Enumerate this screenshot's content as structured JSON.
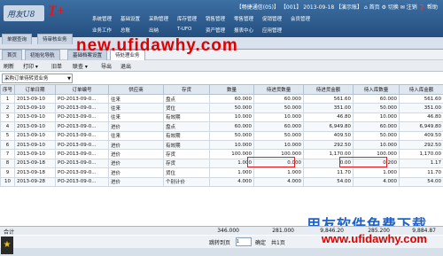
{
  "app": {
    "logo_text": "用友U8",
    "logo_mark": "T+",
    "status": "【畅捷通信(05)】 【001】 2013-09-18 【演示账】 ⌂ 首页 ⚙ 切换 ✉ 注销 ❓ 帮助"
  },
  "menu_row1": [
    "系统管理",
    "基础设置",
    "采购管理",
    "库存管理",
    "销售管理",
    "零售管理",
    "促销管理",
    "会员管理"
  ],
  "menu_row2": [
    "业务工作",
    "总账",
    "出纳",
    "T-UFO",
    "资产管理",
    "报表中心",
    "应用管理"
  ],
  "watermark_top": "new.ufidawhy.com",
  "tabs": {
    "t1": "单据查询",
    "t2": "待审核业务",
    "t3": "首页",
    "t4": "初始化导航",
    "t5": "基础档案设置",
    "t6": "待处理业务"
  },
  "toolbar": {
    "refresh": "刷新",
    "print": "打印 ▾",
    "history": "旧单",
    "link": "联查 ▾",
    "export": "导出",
    "exit": "退出"
  },
  "filter": {
    "value": "采购订单待转货业务"
  },
  "table": {
    "headers": [
      "序号",
      "订单日期",
      "订单编号",
      "供应商",
      "存货",
      "数量",
      "待进货数量",
      "待进货金额",
      "待入库数量",
      "待入库金额"
    ],
    "rows": [
      [
        "1",
        "2013-09-10",
        "PO-2013-09-0...",
        "往来",
        "盘点",
        "60.000",
        "60.000",
        "561.60",
        "60.000",
        "561.60"
      ],
      [
        "2",
        "2013-09-10",
        "PO-2013-09-0...",
        "往来",
        "货位",
        "50.000",
        "50.000",
        "351.00",
        "50.000",
        "351.00"
      ],
      [
        "3",
        "2013-09-10",
        "PO-2013-09-0...",
        "往来",
        "有效期",
        "10.000",
        "10.000",
        "46.80",
        "10.000",
        "46.80"
      ],
      [
        "4",
        "2013-09-10",
        "PO-2013-09-0...",
        "进价",
        "盘点",
        "60.000",
        "60.000",
        "6,949.80",
        "60.000",
        "6,949.80"
      ],
      [
        "5",
        "2013-09-10",
        "PO-2013-09-0...",
        "往来",
        "有效期",
        "50.000",
        "50.000",
        "409.50",
        "50.000",
        "409.50"
      ],
      [
        "6",
        "2013-09-10",
        "PO-2013-09-0...",
        "进价",
        "有效期",
        "10.000",
        "10.000",
        "292.50",
        "10.000",
        "292.50"
      ],
      [
        "7",
        "2013-09-10",
        "PO-2013-09-0...",
        "进价",
        "存货",
        "100.000",
        "100.000",
        "1,170.00",
        "100.000",
        "1,170.00"
      ],
      [
        "8",
        "2013-09-18",
        "PO-2013-09-0...",
        "进价",
        "存货",
        "1.000",
        "0.000",
        "0.00",
        "0.200",
        "1.17"
      ],
      [
        "9",
        "2013-09-18",
        "PO-2013-09-0...",
        "进价",
        "货位",
        "1.000",
        "1.000",
        "11.70",
        "1.000",
        "11.70"
      ],
      [
        "10",
        "2013-09-28",
        "PO-2013-09-0...",
        "进价",
        "个别计价",
        "4.000",
        "4.000",
        "54.00",
        "4.000",
        "54.00"
      ]
    ]
  },
  "summary": {
    "label": "合计",
    "qty": "346.000",
    "pending_in_qty": "281.000",
    "pending_in_amt": "9,846.20",
    "pending_store_qty": "285.200",
    "pending_store_amt": "9,884.87"
  },
  "pager": {
    "goto_label": "跳转到页",
    "page": "1",
    "confirm": "确定",
    "total": "共1页"
  },
  "watermark_bottom_cn": "用友软件免费下载",
  "watermark_bottom_url": "www.ufidawhy.com"
}
